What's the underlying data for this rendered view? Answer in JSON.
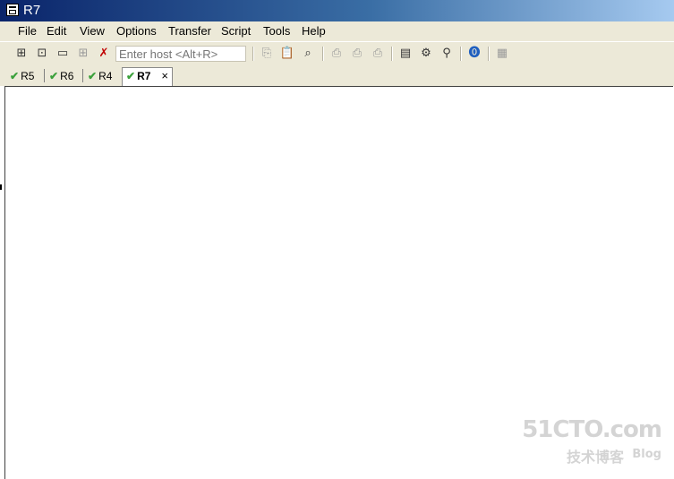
{
  "window": {
    "title": "R7"
  },
  "menu": [
    "File",
    "Edit",
    "View",
    "Options",
    "Transfer",
    "Script",
    "Tools",
    "Help"
  ],
  "toolbar": {
    "host_placeholder": "Enter host <Alt+R>",
    "icons_left": [
      "connect-icon",
      "quick-connect-icon",
      "connect-in-tab-icon",
      "reconnect-icon",
      "disconnect-icon"
    ],
    "icons_right": [
      "copy-icon",
      "paste-icon",
      "find-icon",
      "print-icon",
      "print-selection-icon",
      "print-setup-icon",
      "session-options-icon",
      "global-options-icon",
      "keymap-icon",
      "help-icon",
      "sftp-icon"
    ]
  },
  "tabs": [
    {
      "label": "R5",
      "connected": true,
      "active": false
    },
    {
      "label": "R6",
      "connected": true,
      "active": false
    },
    {
      "label": "R4",
      "connected": true,
      "active": false
    },
    {
      "label": "R7",
      "connected": true,
      "active": true,
      "close": "×"
    }
  ],
  "watermark": {
    "line1": "51CTO.com",
    "line2": "技术博客",
    "line3": "Blog"
  },
  "colors": {
    "titlebar_start": "#0a246a",
    "titlebar_end": "#a6caf0",
    "chrome": "#ece9d8",
    "check": "#3aa03a"
  }
}
